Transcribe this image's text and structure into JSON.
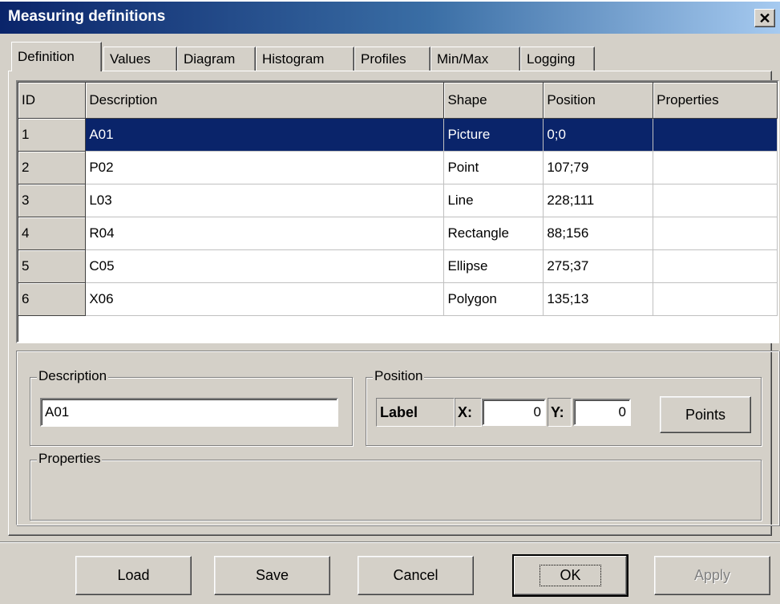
{
  "window": {
    "title": "Measuring definitions",
    "close_glyph": "✕"
  },
  "tabs": [
    {
      "label": "Definition",
      "active": true
    },
    {
      "label": "Values"
    },
    {
      "label": "Diagram"
    },
    {
      "label": "Histogram"
    },
    {
      "label": "Profiles"
    },
    {
      "label": "Min/Max"
    },
    {
      "label": "Logging"
    }
  ],
  "grid": {
    "columns": [
      "ID",
      "Description",
      "Shape",
      "Position",
      "Properties"
    ],
    "rows": [
      {
        "id": "1",
        "description": "A01",
        "shape": "Picture",
        "position": "0;0",
        "properties": ""
      },
      {
        "id": "2",
        "description": "P02",
        "shape": "Point",
        "position": "107;79",
        "properties": ""
      },
      {
        "id": "3",
        "description": "L03",
        "shape": "Line",
        "position": "228;111",
        "properties": ""
      },
      {
        "id": "4",
        "description": "R04",
        "shape": "Rectangle",
        "position": "88;156",
        "properties": ""
      },
      {
        "id": "5",
        "description": "C05",
        "shape": "Ellipse",
        "position": "275;37",
        "properties": ""
      },
      {
        "id": "6",
        "description": "X06",
        "shape": "Polygon",
        "position": "135;13",
        "properties": ""
      }
    ],
    "selected_row": 0
  },
  "details": {
    "description_legend": "Description",
    "description_value": "A01",
    "position_legend": "Position",
    "label_text": "Label",
    "x_label": "X:",
    "x_value": "0",
    "y_label": "Y:",
    "y_value": "0",
    "points_button": "Points",
    "properties_legend": "Properties"
  },
  "footer": {
    "load": "Load",
    "save": "Save",
    "cancel": "Cancel",
    "ok": "OK",
    "apply": "Apply"
  },
  "colors": {
    "title_gradient_start": "#0a246a",
    "title_gradient_end": "#a6caf0",
    "selection": "#0a246a",
    "face": "#d4d0c8"
  }
}
